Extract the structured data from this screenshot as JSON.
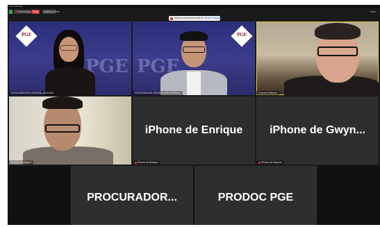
{
  "window": {
    "title": "Zoom Meeting"
  },
  "toolbar": {
    "recording_label": "Recording",
    "stop_label": "Stop",
    "view_label": "Gallery View",
    "right_label": "View"
  },
  "notification": {
    "text": "Setup professional audio in",
    "link": "Studio Settings"
  },
  "participants": [
    {
      "name": "PROCURADORA GENERAL ADJUNTA",
      "label": "",
      "video": true,
      "muted": false,
      "active": false
    },
    {
      "name": "PROCURADOR GENERAL DEL ESTADO",
      "label": "",
      "video": true,
      "muted": false,
      "active": false
    },
    {
      "name": "Gwynne Williams",
      "label": "",
      "video": true,
      "muted": false,
      "active": true
    },
    {
      "name": "Enrique Rodriguez",
      "label": "",
      "video": true,
      "muted": false,
      "active": false
    },
    {
      "name": "iPhone de Enrique",
      "label": "iPhone de Enrique",
      "video": false,
      "muted": true
    },
    {
      "name": "iPhone de Gwynne",
      "label": "iPhone de Gwyn...",
      "video": false,
      "muted": true
    },
    {
      "name": "PROCURADOR",
      "label": "PROCURADOR...",
      "video": false,
      "muted": false
    },
    {
      "name": "PRODOC PGE",
      "label": "PRODOC PGE",
      "video": false,
      "muted": false
    }
  ],
  "branding": {
    "logo_text": "PGE",
    "watermark": "PGE"
  },
  "colors": {
    "active_border": "#e6cf4a",
    "tile_bg": "#2e2e2e",
    "record_red": "#e0302a"
  }
}
